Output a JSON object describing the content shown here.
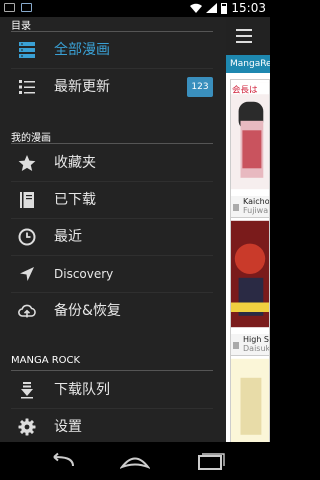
{
  "status_bar": {
    "time": "15:03"
  },
  "drawer": {
    "section_catalog": "目录",
    "catalog_items": [
      {
        "label": "全部漫画",
        "icon": "catalog-icon",
        "active": true
      },
      {
        "label": "最新更新",
        "icon": "list-icon",
        "badge": "123"
      }
    ],
    "section_mine": "我的漫画",
    "mine_items": [
      {
        "label": "收藏夹",
        "icon": "star-icon"
      },
      {
        "label": "已下载",
        "icon": "download-book-icon"
      },
      {
        "label": "最近",
        "icon": "clock-icon"
      },
      {
        "label": "Discovery",
        "icon": "location-arrow-icon"
      },
      {
        "label": "备份&恢复",
        "icon": "cloud-upload-icon"
      }
    ],
    "section_app": "MANGA ROCK",
    "app_items": [
      {
        "label": "下载队列",
        "icon": "download-queue-icon"
      },
      {
        "label": "设置",
        "icon": "gear-icon"
      }
    ]
  },
  "main": {
    "tab_label": "MangaRe",
    "cards": [
      {
        "title": "会長は",
        "caption": "Kaicho",
        "sub": "Fujiwa"
      },
      {
        "title": "",
        "caption": "High S",
        "sub": "Daisuk"
      }
    ]
  },
  "colors": {
    "accent": "#3aa0d4",
    "drawer_bg": "#232323",
    "tab_bg": "#1e88b0"
  }
}
